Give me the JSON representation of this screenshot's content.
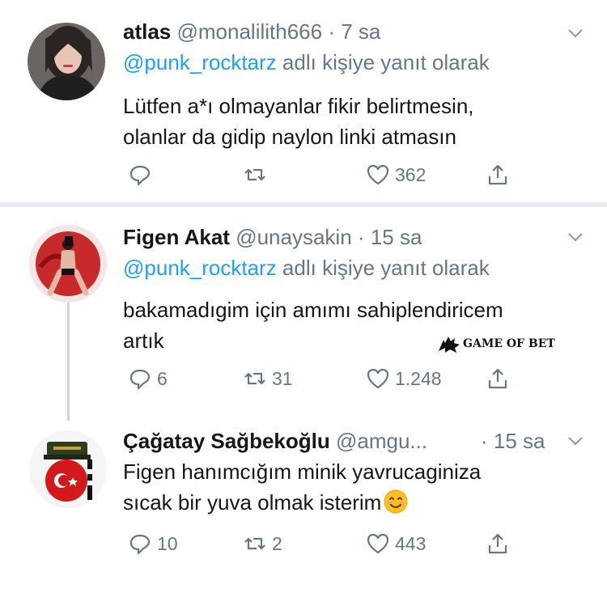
{
  "tweets": [
    {
      "name": "atlas",
      "handle": "@monalilith666",
      "dot": "·",
      "time": "7 sa",
      "reply_mention": "@punk_rocktarz",
      "reply_suffix": " adlı kişiye yanıt olarak",
      "text_lines": [
        "Lütfen a*ı olmayanlar fikir belirtmesin,",
        "olanlar da gidip naylon linki atmasın"
      ],
      "replies": "",
      "retweets": "",
      "likes": "362"
    },
    {
      "name": "Figen Akat",
      "handle": "@unaysakin",
      "dot": "·",
      "time": "15 sa",
      "reply_mention": "@punk_rocktarz",
      "reply_suffix": " adlı kişiye yanıt olarak",
      "text_lines": [
        "bakamadıgim için amımı sahiplendiricem",
        "artık"
      ],
      "replies": "6",
      "retweets": "31",
      "likes": "1.248"
    },
    {
      "name": "Çağatay Sağbekoğlu",
      "handle": "@amgu...",
      "dot": "·",
      "time": "15 sa",
      "text_lines": [
        "Figen hanımcığım minik yavrucaginiza",
        "sıcak bir yuva olmak isterim"
      ],
      "replies": "10",
      "retweets": "2",
      "likes": "443"
    }
  ],
  "watermark": "GAME OF BET",
  "icons": [
    "reply-icon",
    "retweet-icon",
    "like-icon",
    "share-icon",
    "caret-down-icon",
    "smiling-face-emoji"
  ]
}
